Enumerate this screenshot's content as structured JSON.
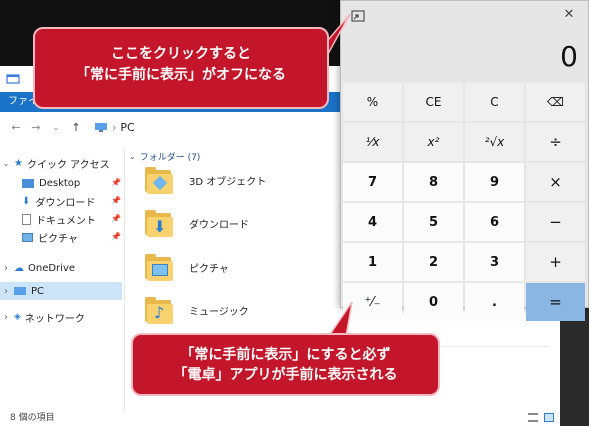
{
  "explorer": {
    "ribbon_file": "ファイル",
    "address": "PC",
    "sidebar": [
      {
        "label": "クイック アクセス",
        "pinned": false
      },
      {
        "label": "Desktop",
        "pinned": true
      },
      {
        "label": "ダウンロード",
        "pinned": true
      },
      {
        "label": "ドキュメント",
        "pinned": true
      },
      {
        "label": "ピクチャ",
        "pinned": true
      },
      {
        "label": "OneDrive",
        "pinned": false
      },
      {
        "label": "PC",
        "pinned": false
      },
      {
        "label": "ネットワーク",
        "pinned": false
      }
    ],
    "folders_header": "フォルダー (7)",
    "folders": [
      "3D オブジェクト",
      "ダウンロード",
      "ピクチャ",
      "ミュージック"
    ],
    "status": "8 個の項目"
  },
  "calculator": {
    "display": "0",
    "close_label": "✕",
    "keys": [
      "%",
      "CE",
      "C",
      "⌫",
      "¹⁄x",
      "x²",
      "²√x",
      "÷",
      "7",
      "8",
      "9",
      "×",
      "4",
      "5",
      "6",
      "−",
      "1",
      "2",
      "3",
      "+",
      "⁺⁄₋",
      "0",
      ".",
      "="
    ]
  },
  "callouts": {
    "top_line1": "ここをクリックすると",
    "top_line2": "「常に手前に表示」がオフになる",
    "bottom_line1": "「常に手前に表示」にすると必ず",
    "bottom_line2": "「電卓」アプリが手前に表示される"
  },
  "colors": {
    "accent": "#1a73c8",
    "callout": "#c4162a",
    "equals_key": "#8ab6e3"
  }
}
